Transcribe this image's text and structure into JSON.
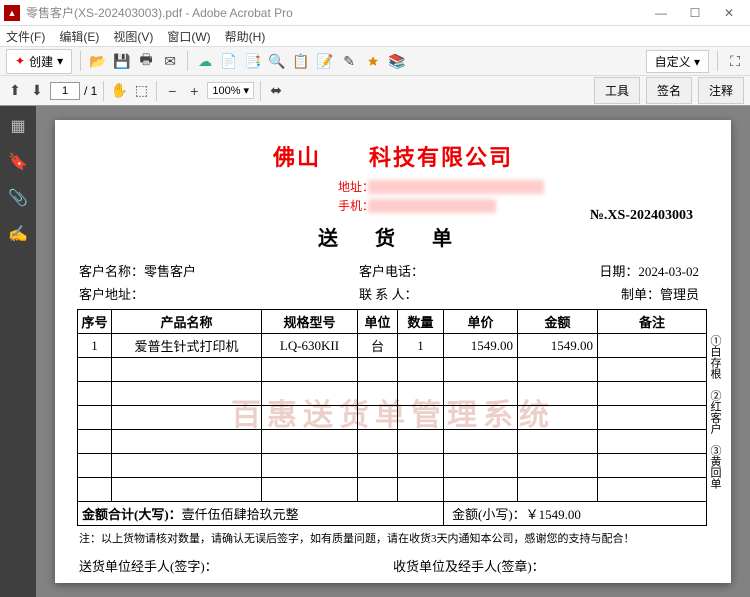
{
  "window": {
    "title": "零售客户(XS-202403003).pdf - Adobe Acrobat Pro"
  },
  "menu": {
    "file": "文件(F)",
    "edit": "编辑(E)",
    "view": "视图(V)",
    "window": "窗口(W)",
    "help": "帮助(H)"
  },
  "toolbar": {
    "create": "创建",
    "custom": "自定义",
    "page_current": "1",
    "page_total": "/ 1",
    "zoom": "100%",
    "btn_tools": "工具",
    "btn_sign": "签名",
    "btn_comment": "注释"
  },
  "doc": {
    "company": "佛山　　科技有限公司",
    "addr_label": "地址：",
    "phone_label": "手机：",
    "title": "送 货 单",
    "order_no": "№.XS-202403003",
    "cust_name_label": "客户名称：",
    "cust_name": "零售客户",
    "cust_phone_label": "客户电话：",
    "date_label": "日期：",
    "date": "2024-03-02",
    "cust_addr_label": "客户地址：",
    "contact_label": "联 系 人：",
    "maker_label": "制单：",
    "maker": "管理员",
    "headers": {
      "seq": "序号",
      "name": "产品名称",
      "spec": "规格型号",
      "unit": "单位",
      "qty": "数量",
      "price": "单价",
      "amount": "金额",
      "note": "备注"
    },
    "row1": {
      "seq": "1",
      "name": "爱普生针式打印机",
      "spec": "LQ-630KII",
      "unit": "台",
      "qty": "1",
      "price": "1549.00",
      "amount": "1549.00",
      "note": ""
    },
    "total_label": "金额合计(大写)：",
    "total_cn": "壹仟伍佰肆拾玖元整",
    "total_small_label": "金额(小写)：",
    "total_small": "￥1549.00",
    "note_line": "注：以上货物请核对数量，请确认无误后签字，如有质量问题，请在收货3天内通知本公司，感谢您的支持与配合！",
    "sig_send": "送货单位经手人(签字)：",
    "sig_recv": "收货单位及经手人(签章)：",
    "side_note": "①白存根　②红客户　③黄回单",
    "watermark": "百惠送货单管理系统"
  }
}
